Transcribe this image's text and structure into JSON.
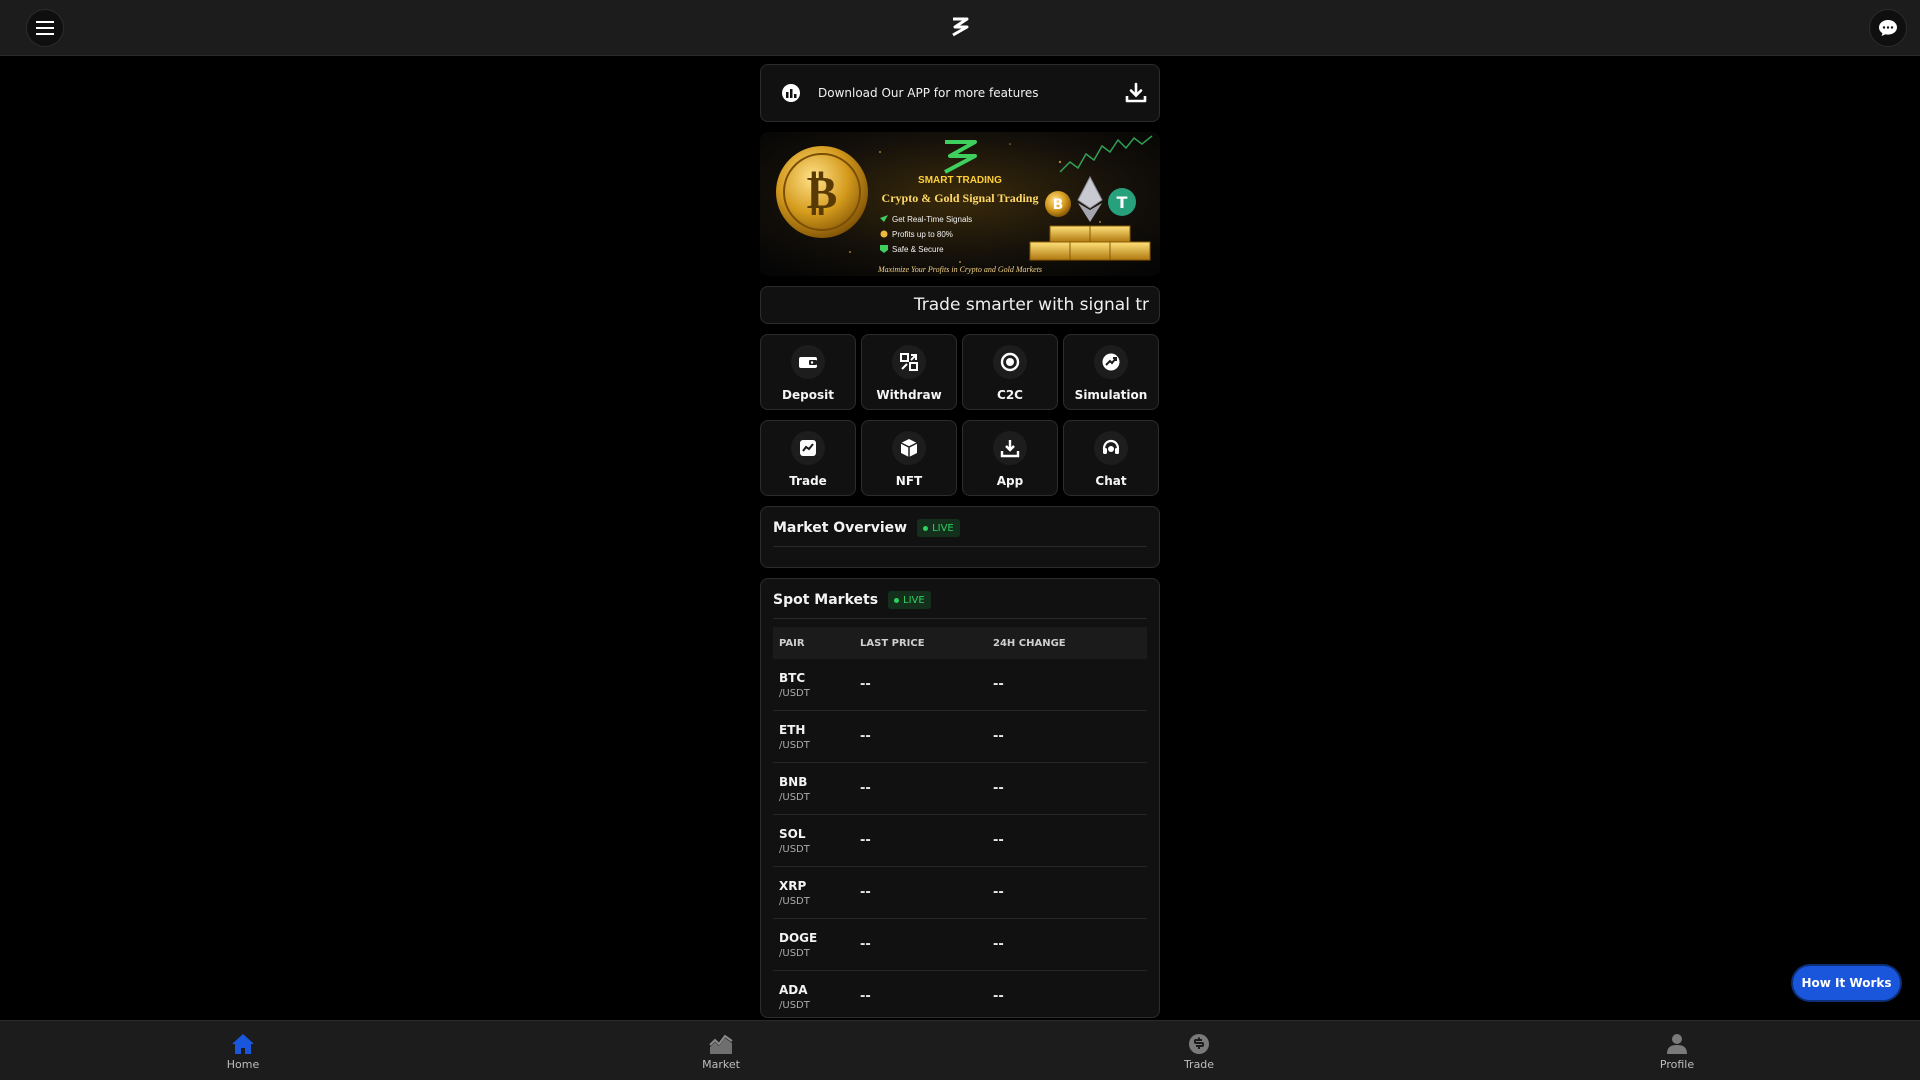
{
  "download_bar": {
    "text": "Download Our APP for more features"
  },
  "banner": {
    "brand": "SMART TRADING",
    "headline": "Crypto & Gold Signal Trading",
    "bullets": [
      "Get Real-Time Signals",
      "Profits up to 80%",
      "Safe & Secure"
    ],
    "tagline": "Maximize Your Profits in Crypto and Gold Markets"
  },
  "ticker": {
    "text": "Trade smarter with signal tr"
  },
  "quick_actions": [
    {
      "label": "Deposit",
      "icon": "wallet-icon"
    },
    {
      "label": "Withdraw",
      "icon": "transfer-icon"
    },
    {
      "label": "C2C",
      "icon": "c2c-icon"
    },
    {
      "label": "Simulation",
      "icon": "simulation-icon"
    },
    {
      "label": "Trade",
      "icon": "chart-icon"
    },
    {
      "label": "NFT",
      "icon": "cube-icon"
    },
    {
      "label": "App",
      "icon": "download-icon"
    },
    {
      "label": "Chat",
      "icon": "headset-icon"
    }
  ],
  "market_overview": {
    "title": "Market Overview",
    "badge": "LIVE"
  },
  "spot_markets": {
    "title": "Spot Markets",
    "badge": "LIVE",
    "columns": [
      "PAIR",
      "LAST PRICE",
      "24H CHANGE"
    ],
    "rows": [
      {
        "base": "BTC",
        "quote": "/USDT",
        "price": "--",
        "change": "--"
      },
      {
        "base": "ETH",
        "quote": "/USDT",
        "price": "--",
        "change": "--"
      },
      {
        "base": "BNB",
        "quote": "/USDT",
        "price": "--",
        "change": "--"
      },
      {
        "base": "SOL",
        "quote": "/USDT",
        "price": "--",
        "change": "--"
      },
      {
        "base": "XRP",
        "quote": "/USDT",
        "price": "--",
        "change": "--"
      },
      {
        "base": "DOGE",
        "quote": "/USDT",
        "price": "--",
        "change": "--"
      },
      {
        "base": "ADA",
        "quote": "/USDT",
        "price": "--",
        "change": "--"
      }
    ]
  },
  "how_it_works": {
    "label": "How It Works"
  },
  "bottom_nav": [
    {
      "label": "Home",
      "icon": "home-icon",
      "active": true
    },
    {
      "label": "Market",
      "icon": "market-icon",
      "active": false
    },
    {
      "label": "Trade",
      "icon": "trade-coin-icon",
      "active": false
    },
    {
      "label": "Profile",
      "icon": "profile-icon",
      "active": false
    }
  ],
  "colors": {
    "accent": "#1a56db",
    "live_green": "#2fcf5f",
    "home_active": "#1a56db"
  }
}
